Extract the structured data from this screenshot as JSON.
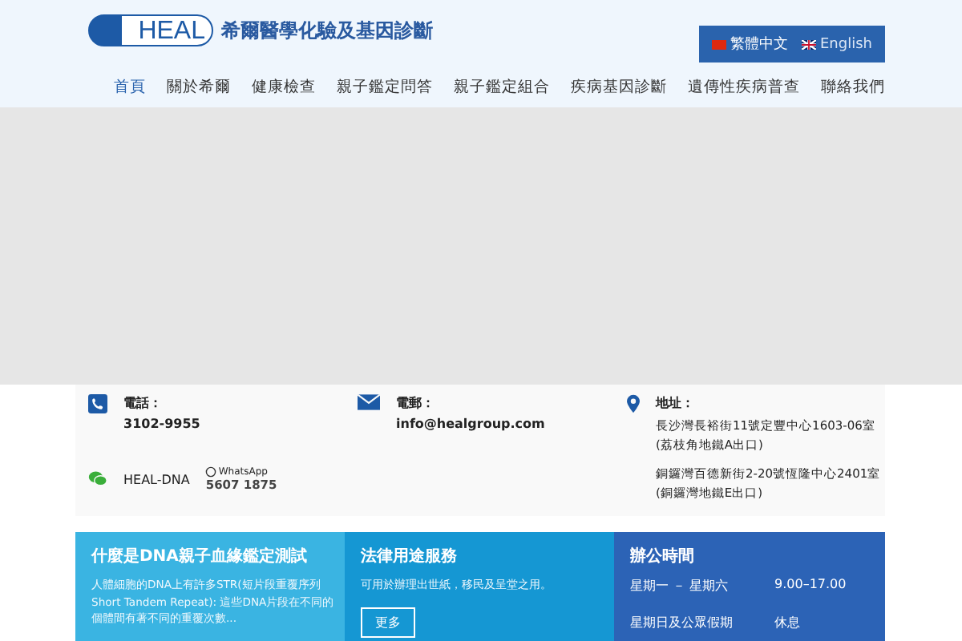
{
  "header": {
    "logo": "HEAL",
    "brand": "希爾醫學化驗及基因診斷",
    "languages": [
      {
        "label": "繁體中文",
        "selected": true
      },
      {
        "label": "English",
        "selected": false
      }
    ]
  },
  "nav": [
    {
      "label": "首頁",
      "selected": true
    },
    {
      "label": "關於希爾",
      "selected": false
    },
    {
      "label": "健康檢查",
      "selected": false
    },
    {
      "label": "親子鑑定問答",
      "selected": false
    },
    {
      "label": "親子鑑定組合",
      "selected": false
    },
    {
      "label": "疾病基因診斷",
      "selected": false
    },
    {
      "label": "遺傳性疾病普查",
      "selected": false
    },
    {
      "label": "聯絡我們",
      "selected": false
    }
  ],
  "contact": {
    "phone": {
      "label": "電話：",
      "value": "3102-9955"
    },
    "email": {
      "label": "電郵：",
      "value": "info@healgroup.com"
    },
    "address": {
      "label": "地址：",
      "lines": [
        "長沙灣長裕街11號定豐中心1603-06室",
        "(荔枝角地鐵A出口)",
        "銅鑼灣百德新街2-20號恆隆中心2401室",
        "(銅鑼灣地鐵E出口)"
      ]
    },
    "wechat": "HEAL-DNA",
    "whatsapp": {
      "label": "WhatsApp",
      "number": "5607 1875"
    }
  },
  "cards": [
    {
      "title": "什麼是DNA親子血緣鑑定測試",
      "text": "人體細胞的DNA上有許多STR(短片段重覆序列Short Tandem Repeat): 這些DNA片段在不同的個體間有著不同的重覆次數..."
    },
    {
      "title": "法律用途服務",
      "text": "可用於辦理出世紙，移民及呈堂之用。",
      "button": "更多"
    },
    {
      "title": "辦公時間",
      "hours": [
        {
          "days": "星期一 － 星期六",
          "time": "9.00–17.00"
        },
        {
          "days": "星期日及公眾假期",
          "time": "休息"
        }
      ]
    }
  ]
}
